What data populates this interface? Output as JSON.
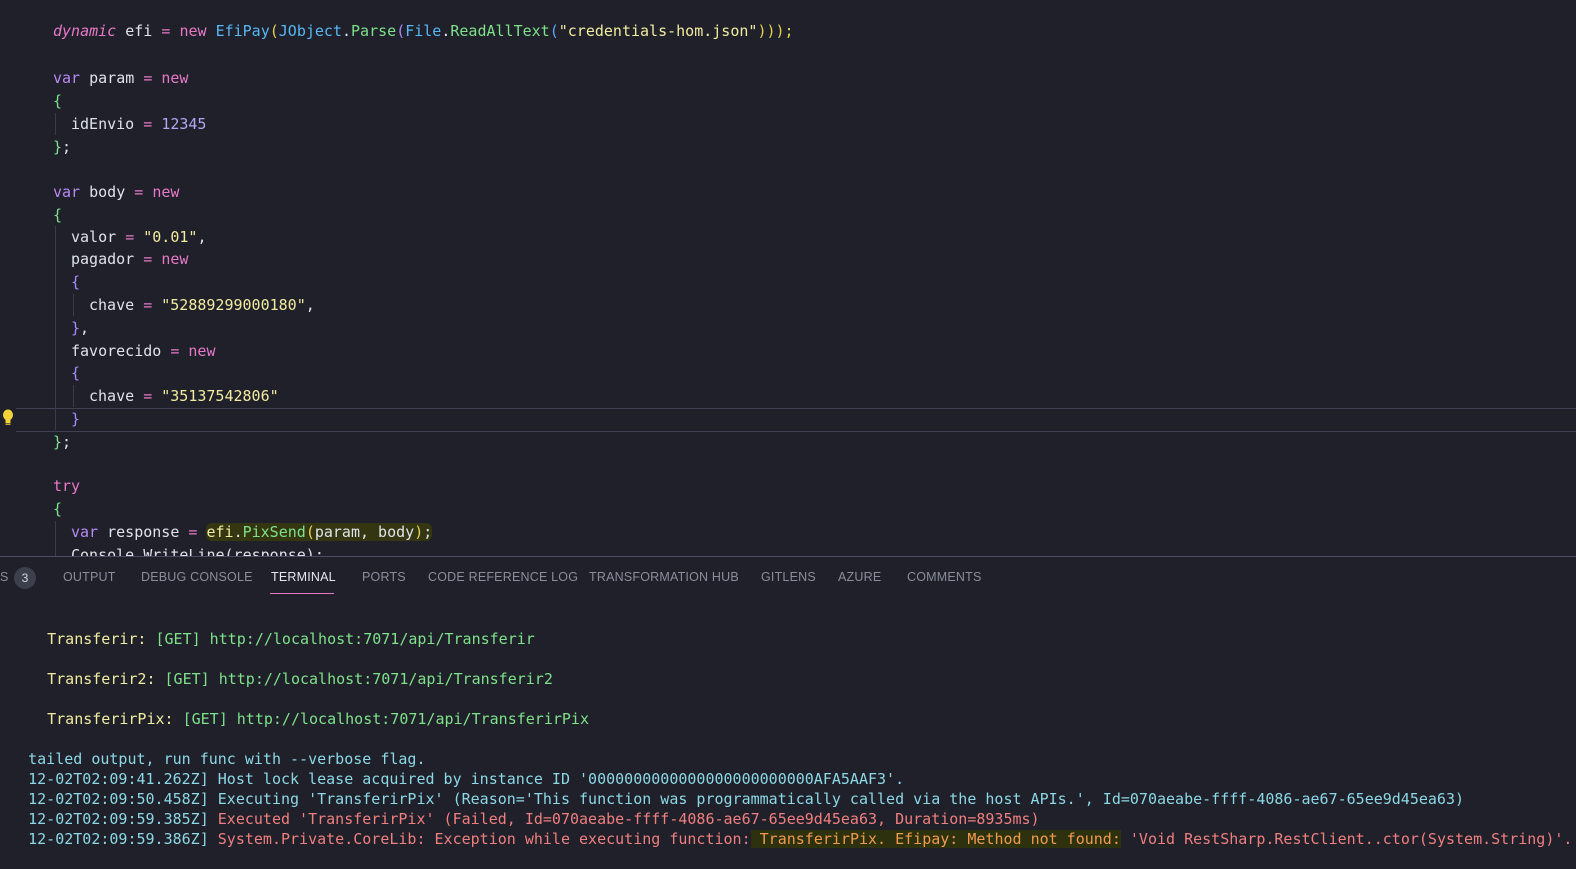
{
  "editor": {
    "lines": {
      "l1": {
        "kw": "dynamic",
        "rest1": " efi ",
        "op": "=",
        "sp": " ",
        "new": "new",
        "sp2": " ",
        "type1": "EfiPay",
        "p1": "(",
        "type2": "JObject",
        "dot": ".",
        "fn1": "Parse",
        "p2": "(",
        "type3": "File",
        "dot2": ".",
        "fn2": "ReadAllText",
        "p3": "(",
        "str": "\"credentials-hom.json\"",
        "close": ")));"
      },
      "l2": {
        "kw": "var",
        "name": " param ",
        "op": "=",
        "sp": " ",
        "new": "new"
      },
      "l3": {
        "brace": "{"
      },
      "l4": {
        "name": "idEnvio ",
        "op": "=",
        "sp": " ",
        "num": "12345"
      },
      "l5": {
        "brace": "}",
        "semi": ";"
      },
      "l6": {
        "kw": "var",
        "name": " body ",
        "op": "=",
        "sp": " ",
        "new": "new"
      },
      "l7": {
        "brace": "{"
      },
      "l8": {
        "name": "valor ",
        "op": "=",
        "sp": " ",
        "str": "\"0.01\"",
        "comma": ","
      },
      "l9": {
        "name": "pagador ",
        "op": "=",
        "sp": " ",
        "new": "new"
      },
      "l10": {
        "brace": "{"
      },
      "l11": {
        "name": "chave ",
        "op": "=",
        "sp": " ",
        "str": "\"52889299000180\"",
        "comma": ","
      },
      "l12": {
        "brace": "}",
        "comma": ","
      },
      "l13": {
        "name": "favorecido ",
        "op": "=",
        "sp": " ",
        "new": "new"
      },
      "l14": {
        "brace": "{"
      },
      "l15": {
        "name": "chave ",
        "op": "=",
        "sp": " ",
        "str": "\"35137542806\""
      },
      "l16": {
        "brace": "}"
      },
      "l17": {
        "brace": "}",
        "semi": ";"
      },
      "l18": {
        "kw": "try"
      },
      "l19": {
        "brace": "{"
      },
      "l20": {
        "kw": "var",
        "name": " response ",
        "op": "=",
        "sp": " ",
        "obj": "efi",
        "dot": ".",
        "fn": "PixSend",
        "p1": "(",
        "args": "param, body",
        "p2": ")",
        "semi": ";"
      },
      "l21": {
        "text": "Console.WriteLine(response);"
      }
    }
  },
  "panel": {
    "tabs": {
      "prefix": "S",
      "problems_count": "3",
      "output": "OUTPUT",
      "debug_console": "DEBUG CONSOLE",
      "terminal": "TERMINAL",
      "ports": "PORTS",
      "code_reference_log": "CODE REFERENCE LOG",
      "transformation_hub": "TRANSFORMATION HUB",
      "gitlens": "GITLENS",
      "azure": "AZURE",
      "comments": "COMMENTS"
    },
    "terminal": {
      "f1_name": "Transferir:",
      "f1_method": " [GET] http://localhost:7071/api/Transferir",
      "f2_name": "Transferir2:",
      "f2_method": " [GET] http://localhost:7071/api/Transferir2",
      "f3_name": "TransferirPix:",
      "f3_method": " [GET] http://localhost:7071/api/TransferirPix",
      "verbose": "tailed output, run func with --verbose flag.",
      "log1_ts": "12-02T02:09:41.262Z]",
      "log1_msg": " Host lock lease acquired by instance ID '0000000000000000000000000AFA5AAF3'.",
      "log2_ts": "12-02T02:09:50.458Z]",
      "log2_msg": " Executing 'TransferirPix' (Reason='This function was programmatically called via the host APIs.', Id=070aeabe-ffff-4086-ae67-65ee9d45ea63)",
      "log3_ts": "12-02T02:09:59.385Z]",
      "log3_msg": " Executed 'TransferirPix' (Failed, Id=070aeabe-ffff-4086-ae67-65ee9d45ea63, Duration=8935ms)",
      "log4_ts": "12-02T02:09:59.386Z]",
      "log4_msg_a": " System.Private.CoreLib: Exception while executing function:",
      "log4_msg_b": " TransferirPix. Efipay: Method not found:",
      "log4_msg_c": " 'Void RestSharp.RestClient..ctor(System.String)'."
    }
  },
  "colors": {
    "background": "#1f2029",
    "keyword": "#b989f6",
    "operator": "#e879c9",
    "type": "#58b8f5",
    "function": "#7ee28a",
    "string": "#f2eca0",
    "error": "#f07f7f",
    "warning": "#f09a4c"
  },
  "icons": {
    "lightbulb": "lightbulb-icon"
  }
}
